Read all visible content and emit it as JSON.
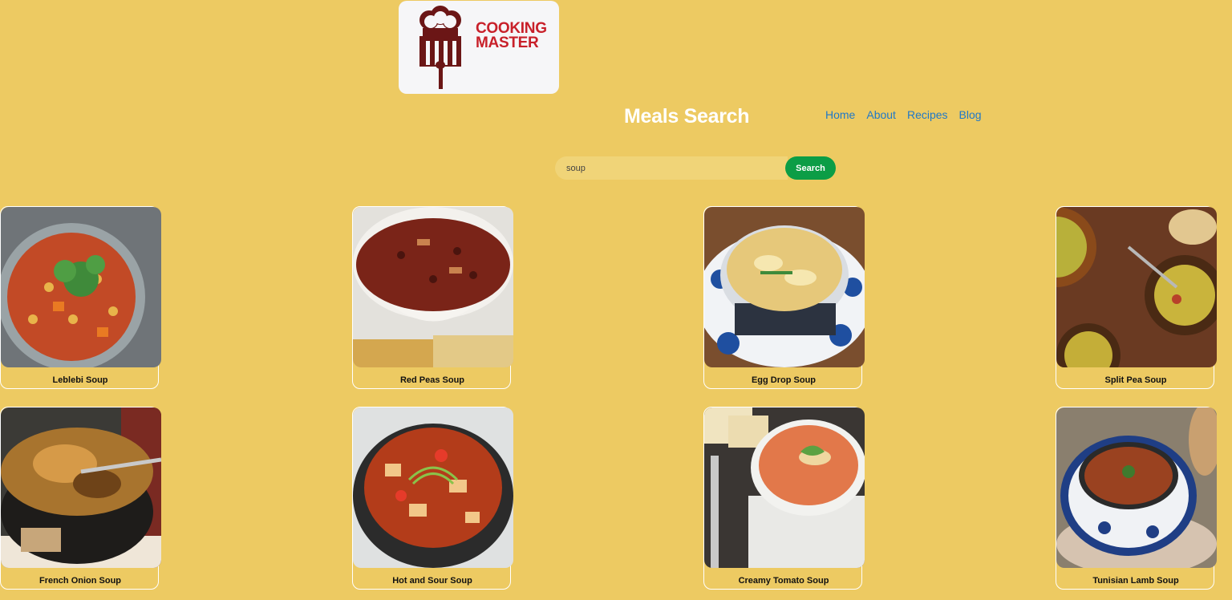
{
  "logo": {
    "line1": "COOKING",
    "line2": "MASTER"
  },
  "header": {
    "title": "Meals Search"
  },
  "nav": {
    "items": [
      "Home",
      "About",
      "Recipes",
      "Blog"
    ]
  },
  "search": {
    "value": "soup",
    "button_label": "Search"
  },
  "meals": [
    "Leblebi Soup",
    "Red Peas Soup",
    "Egg Drop Soup",
    "Split Pea Soup",
    "French Onion Soup",
    "Hot and Sour Soup",
    "Creamy Tomato Soup",
    "Tunisian Lamb Soup"
  ],
  "colors": {
    "background": "#edca62",
    "search_button": "#0c9d46",
    "nav_link": "#1f78c8",
    "logo_text": "#c8202a"
  }
}
